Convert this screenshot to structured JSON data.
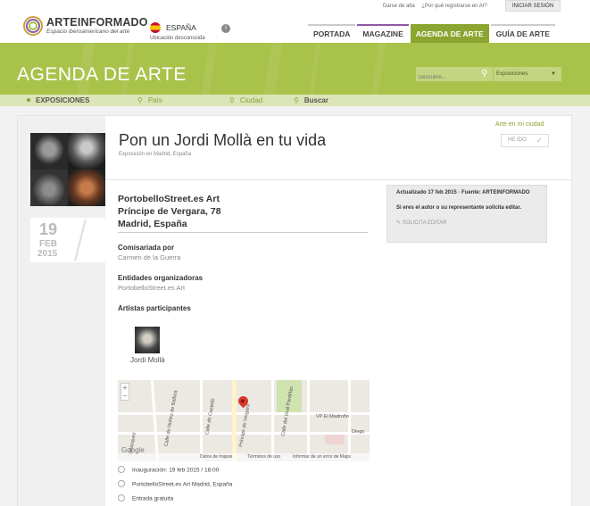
{
  "brand": {
    "name": "ARTEINFORMADO",
    "tagline": "Espacio iberoamericano del arte"
  },
  "country": {
    "name": "ESPAÑA",
    "location_note": "Ubicación desconocida",
    "info_icon": "i"
  },
  "top_links": {
    "register": "Darse de alta",
    "why_register": "¿Por qué registrarse en AI?",
    "login": "INICIAR SESIÓN"
  },
  "nav": {
    "items": [
      {
        "label": "PORTADA"
      },
      {
        "label": "MAGAZINE"
      },
      {
        "label": "AGENDA DE ARTE"
      },
      {
        "label": "GUÍA DE ARTE"
      }
    ],
    "active_index": 2
  },
  "banner": {
    "title": "AGENDA DE ARTE",
    "search_placeholder": "Descubre...",
    "type_select": "Exposiciones"
  },
  "filters": {
    "type": "EXPOSICIONES",
    "country": "País",
    "city": "Ciudad",
    "search": "Buscar"
  },
  "event": {
    "title": "Pon un Jordi Mollà en tu vida",
    "subtitle": "Exposición en Madrid, España",
    "my_city_link": "Arte en mi ciudad",
    "done_button": "HE IDO",
    "date": {
      "day": "19",
      "month": "FEB",
      "year": "2015"
    },
    "venue": {
      "name": "PortobelloStreet.es Art",
      "street": "Príncipe de Vergara, 78",
      "city": "Madrid, España"
    },
    "curated_label": "Comisariada por",
    "curated_value": "Carmen de la Guerra",
    "organizers_label": "Entidades organizadoras",
    "organizers_value": "PortobelloStreet.es Art",
    "artists_label": "Artistas participantes",
    "artists": [
      {
        "name": "Jordi Mollà"
      }
    ],
    "info_box": {
      "updated": "Actualizado 17 feb 2015 · Fuente: ARTEINFORMADO",
      "owner_note": "Si eres el autor o su representante solicita editar.",
      "edit_request": "SOLICITA EDITAR"
    },
    "map": {
      "streets": [
        "Calle de Núñez de Balboa",
        "Calle de Castelló",
        "Príncipe de Vergara",
        "Calle del Gral Pardiñas",
        "Velázquez"
      ],
      "poi": "VP El Madroño",
      "metro": "Diego",
      "brand": "Google",
      "footer": [
        "Datos de mapas",
        "Términos de uso",
        "Informar de un error de Maps"
      ]
    },
    "meta": {
      "opening": "Inauguración: 19 feb 2015  /  18:00",
      "address": "PortobelloStreet.es Art Madrid, España",
      "entry": "Entrada gratuita"
    }
  },
  "colors": {
    "accent_green": "#8ca530",
    "banner_green": "#a9c24a",
    "magazine_purple": "#8e5aa5",
    "map_pin": "#d7392c"
  }
}
